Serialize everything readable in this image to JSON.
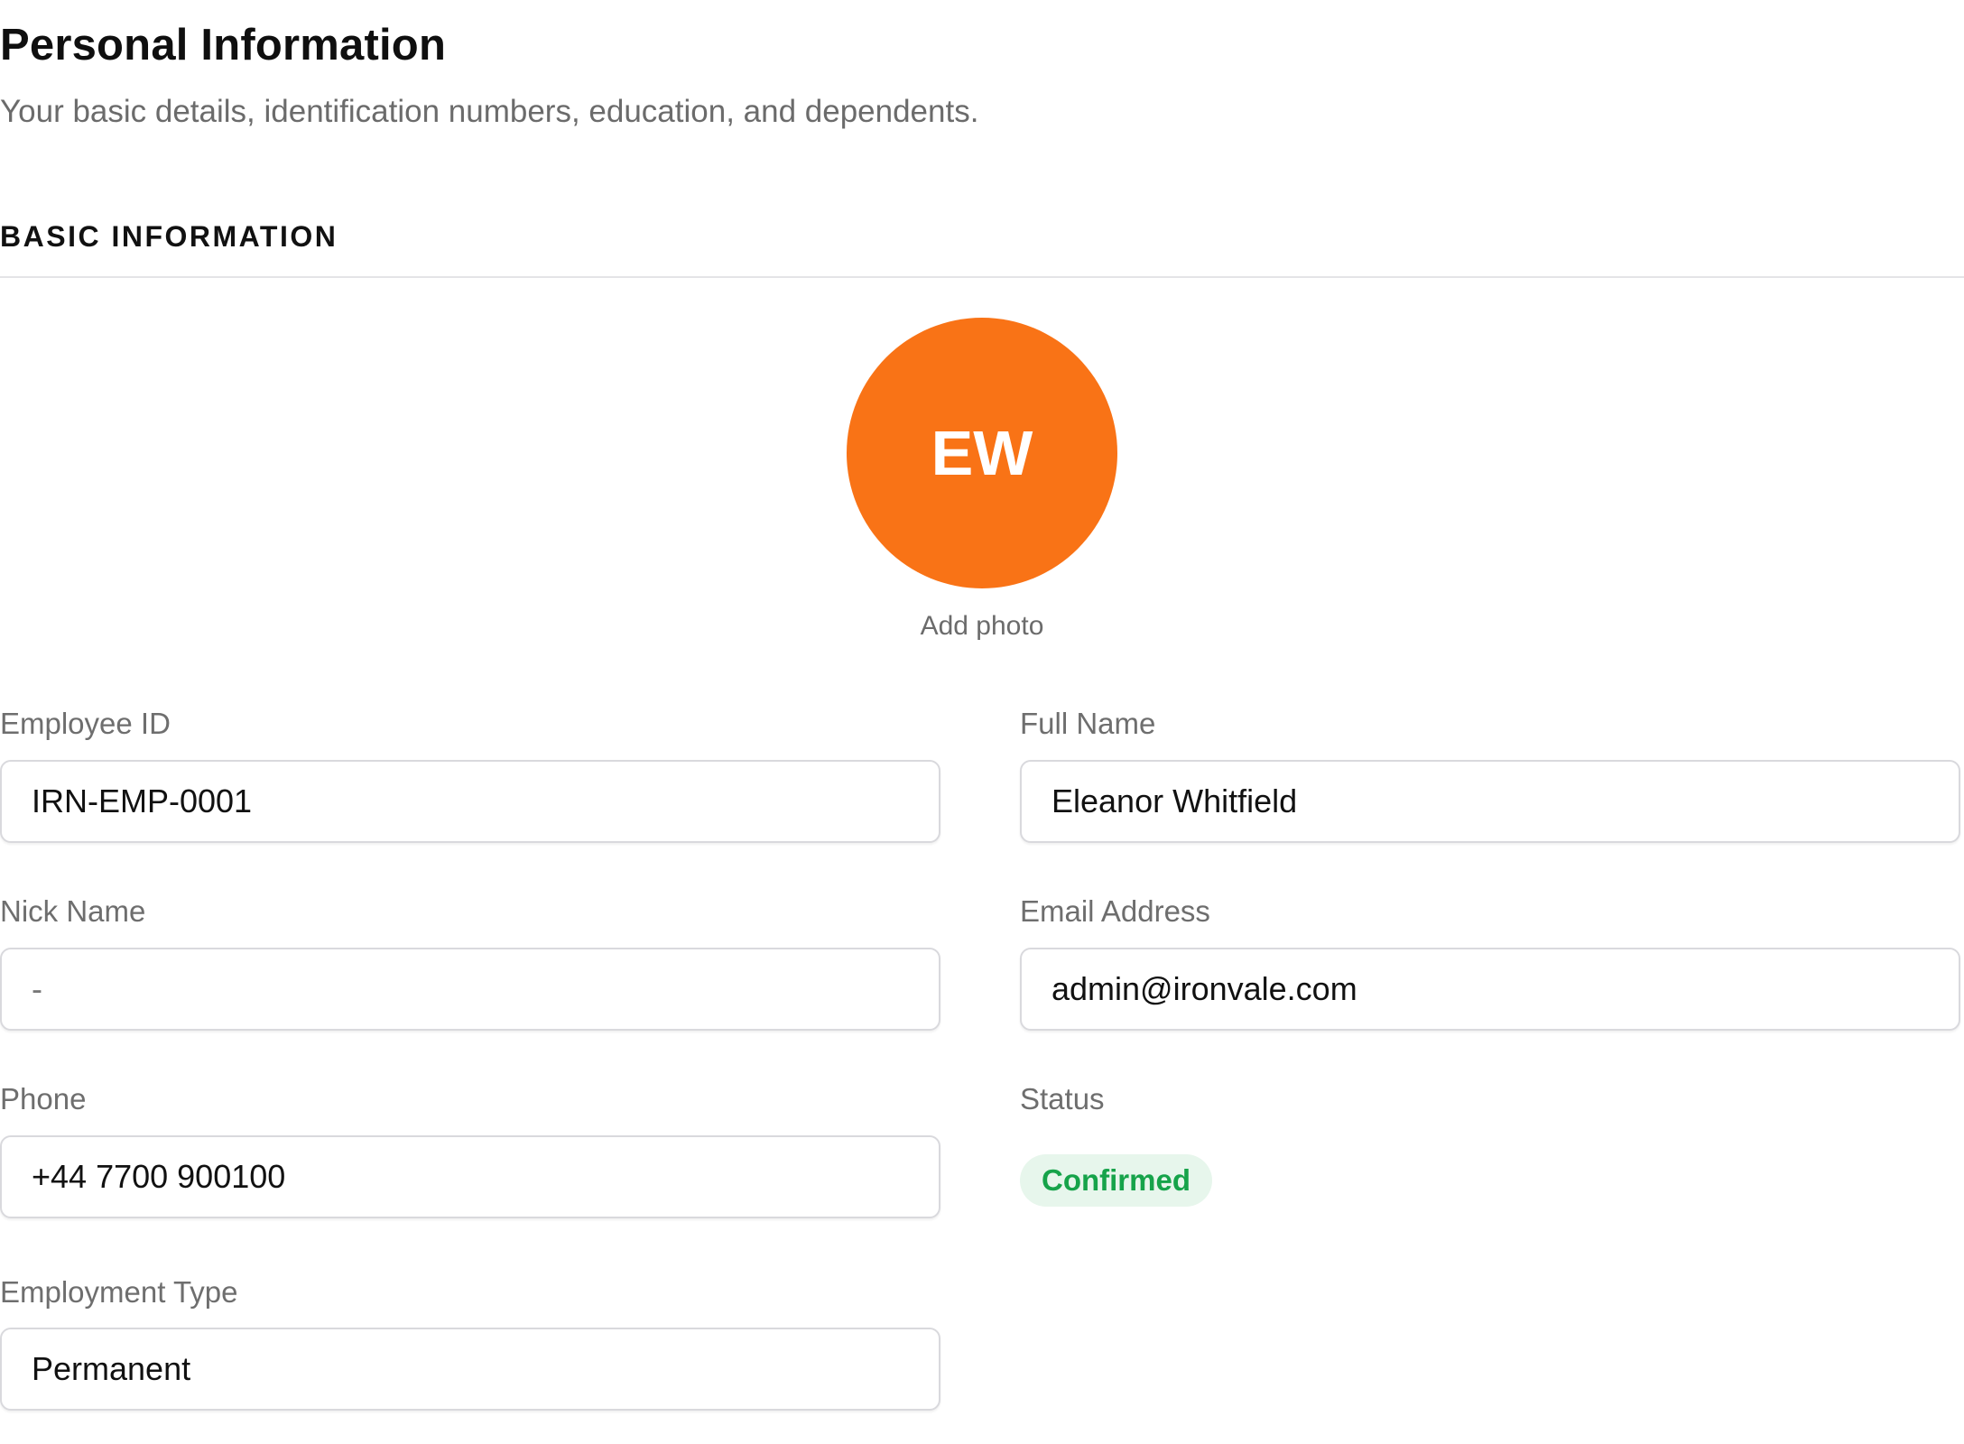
{
  "header": {
    "title": "Personal Information",
    "subtitle": "Your basic details, identification numbers, education, and dependents."
  },
  "section": {
    "title": "BASIC INFORMATION"
  },
  "avatar": {
    "initials": "EW",
    "color": "#F97316",
    "add_photo_label": "Add photo"
  },
  "fields": {
    "employee_id": {
      "label": "Employee ID",
      "value": "IRN-EMP-0001"
    },
    "full_name": {
      "label": "Full Name",
      "value": "Eleanor Whitfield"
    },
    "nick_name": {
      "label": "Nick Name",
      "value": "-"
    },
    "email": {
      "label": "Email Address",
      "value": "admin@ironvale.com"
    },
    "phone": {
      "label": "Phone",
      "value": "+44 7700 900100"
    },
    "status": {
      "label": "Status",
      "value": "Confirmed",
      "color": "#16A34A",
      "background": "#E7F6EC"
    },
    "employment_type": {
      "label": "Employment Type",
      "value": "Permanent"
    }
  }
}
